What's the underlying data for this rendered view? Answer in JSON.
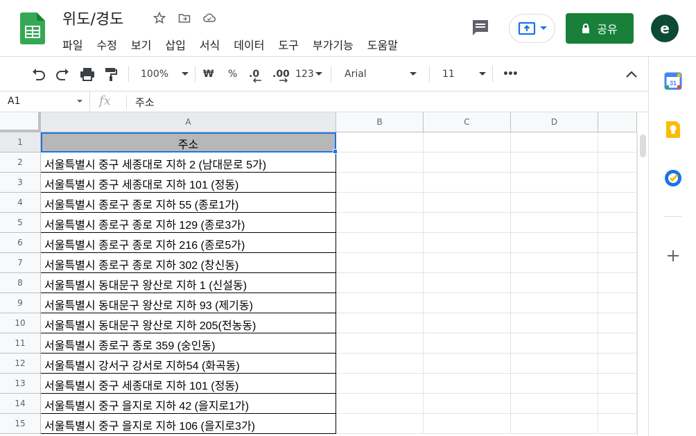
{
  "doc": {
    "title": "위도/경도"
  },
  "menu": [
    "파일",
    "수정",
    "보기",
    "삽입",
    "서식",
    "데이터",
    "도구",
    "부가기능",
    "도움말"
  ],
  "share": {
    "label": "공유"
  },
  "avatar": {
    "initial": "e"
  },
  "toolbar": {
    "zoom": "100%",
    "currency": "₩",
    "percent": "%",
    "dec_less": ".0",
    "dec_more": ".00",
    "format_123": "123",
    "font": "Arial",
    "font_size": "11",
    "more": "•••"
  },
  "formula_bar": {
    "cell_ref": "A1",
    "fx": "fx",
    "value": "주소"
  },
  "columns": [
    "A",
    "B",
    "C",
    "D"
  ],
  "rows": [
    {
      "num": "1",
      "a": "주소"
    },
    {
      "num": "2",
      "a": "서울특별시 중구 세종대로 지하 2 (남대문로 5가)"
    },
    {
      "num": "3",
      "a": "서울특별시 중구 세종대로 지하 101 (정동)"
    },
    {
      "num": "4",
      "a": "서울특별시 종로구 종로 지하 55 (종로1가)"
    },
    {
      "num": "5",
      "a": "서울특별시 종로구 종로 지하 129 (종로3가)"
    },
    {
      "num": "6",
      "a": "서울특별시 종로구 종로 지하 216 (종로5가)"
    },
    {
      "num": "7",
      "a": "서울특별시 종로구 종로 지하 302 (창신동)"
    },
    {
      "num": "8",
      "a": "서울특별시 동대문구 왕산로 지하 1 (신설동)"
    },
    {
      "num": "9",
      "a": "서울특별시 동대문구 왕산로 지하 93 (제기동)"
    },
    {
      "num": "10",
      "a": "서울특별시 동대문구 왕산로 지하 205(전농동)"
    },
    {
      "num": "11",
      "a": "서울특별시 종로구 종로 359 (숭인동)"
    },
    {
      "num": "12",
      "a": "서울특별시 강서구 강서로 지하54 (화곡동)"
    },
    {
      "num": "13",
      "a": "서울특별시 중구 세종대로 지하 101 (정동)"
    },
    {
      "num": "14",
      "a": "서울특별시 중구 을지로 지하 42 (을지로1가)"
    },
    {
      "num": "15",
      "a": "서울특별시 중구 을지로 지하 106 (을지로3가)"
    }
  ],
  "colors": {
    "share_green": "#188038",
    "avatar": "#0d4a35",
    "header_fill": "#b7b7b7",
    "selection": "#1a73e8"
  },
  "side_icons": [
    "calendar-icon",
    "keep-icon",
    "tasks-icon",
    "add-icon"
  ]
}
